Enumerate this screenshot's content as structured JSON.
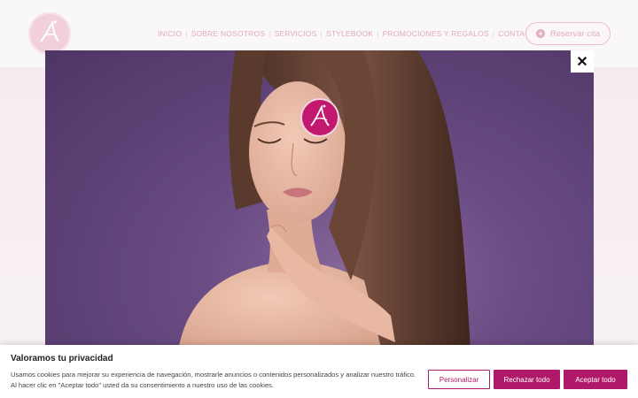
{
  "header": {
    "nav": [
      "INICIO",
      "SOBRE NOSOTROS",
      "SERVICIOS",
      "STYLEBOOK",
      "PROMOCIONES Y REGALOS",
      "CONTACTO"
    ],
    "reserve_label": "Reservar cita"
  },
  "lightbox": {
    "close_symbol": "✕"
  },
  "cookie": {
    "title": "Valoramos tu privacidad",
    "text": "Usamos cookies para mejorar su experiencia de navegación, mostrarle anuncios o contenidos personalizados y analizar nuestro tráfico. Al hacer clic en \"Aceptar todo\" usted da su consentimiento a nuestro uso de las cookies.",
    "customize_label": "Personalizar",
    "reject_label": "Rechazar todo",
    "accept_label": "Aceptar todo"
  },
  "colors": {
    "brand_pink": "#d98fb0",
    "button_magenta": "#b0196a",
    "photo_background": "#5e4277"
  },
  "icons": [
    "site-logo-icon",
    "plus-circle-icon",
    "close-icon",
    "photo-watermark-logo-icon"
  ]
}
